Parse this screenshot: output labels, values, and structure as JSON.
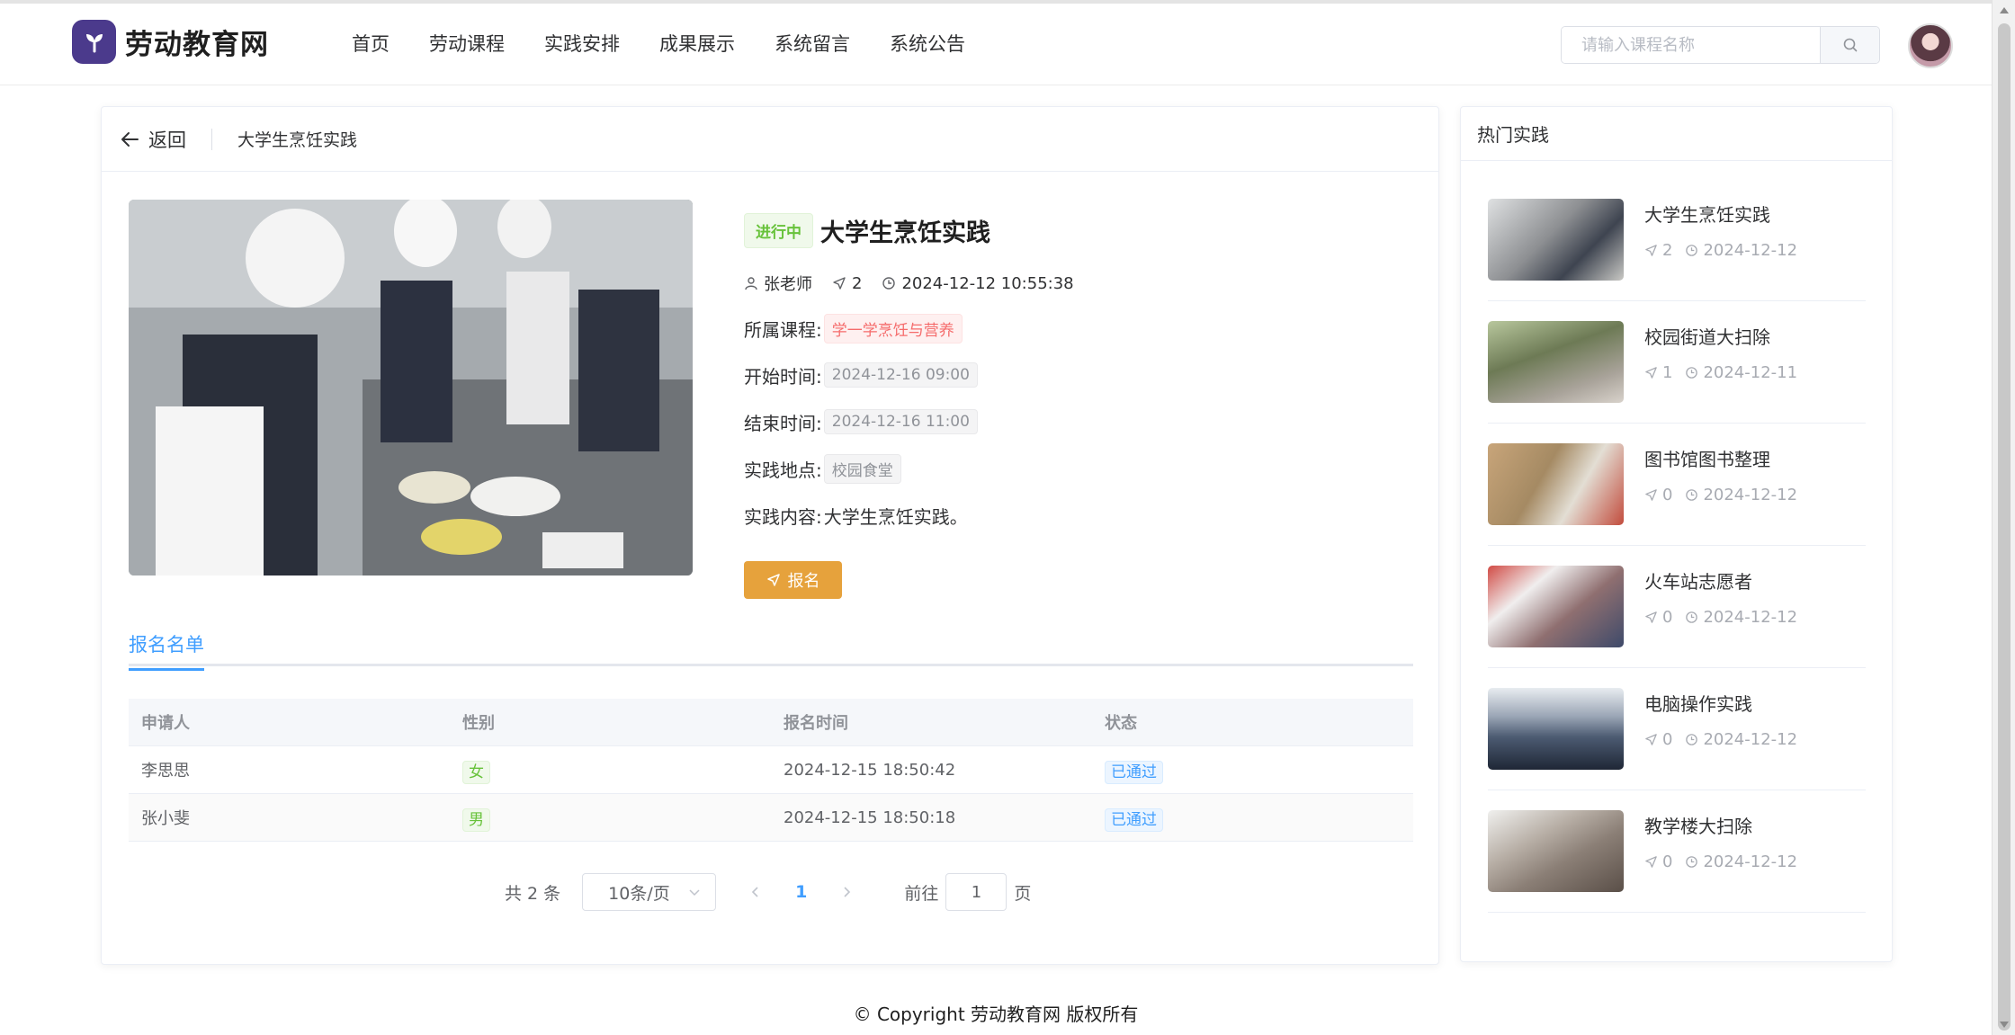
{
  "header": {
    "logo_text": "劳动教育网",
    "nav": [
      "首页",
      "劳动课程",
      "实践安排",
      "成果展示",
      "系统留言",
      "系统公告"
    ],
    "search_placeholder": "请输入课程名称"
  },
  "breadcrumb": {
    "back_label": "返回",
    "current": "大学生烹饪实践"
  },
  "detail": {
    "status": "进行中",
    "title": "大学生烹饪实践",
    "teacher": "张老师",
    "signup_count": "2",
    "published": "2024-12-12 10:55:38",
    "course_label": "所属课程:",
    "course": "学一学烹饪与营养",
    "start_label": "开始时间:",
    "start": "2024-12-16 09:00",
    "end_label": "结束时间:",
    "end": "2024-12-16 11:00",
    "location_label": "实践地点:",
    "location": "校园食堂",
    "content_label": "实践内容:",
    "content": "大学生烹饪实践。",
    "signup_button": "报名"
  },
  "tabs": {
    "active": "报名名单"
  },
  "table": {
    "headers": [
      "申请人",
      "性别",
      "报名时间",
      "状态"
    ],
    "rows": [
      {
        "name": "李思思",
        "gender": "女",
        "time": "2024-12-15 18:50:42",
        "status": "已通过"
      },
      {
        "name": "张小斐",
        "gender": "男",
        "time": "2024-12-15 18:50:18",
        "status": "已通过"
      }
    ]
  },
  "pagination": {
    "total": "共 2 条",
    "page_size": "10条/页",
    "current_page": "1",
    "goto_label": "前往",
    "goto_value": "1",
    "goto_suffix": "页"
  },
  "side": {
    "title": "热门实践",
    "items": [
      {
        "title": "大学生烹饪实践",
        "count": "2",
        "date": "2024-12-12",
        "color": "#8d8f92"
      },
      {
        "title": "校园街道大扫除",
        "count": "1",
        "date": "2024-12-11",
        "color": "#6d7a55"
      },
      {
        "title": "图书馆图书整理",
        "count": "0",
        "date": "2024-12-12",
        "color": "#a58a63"
      },
      {
        "title": "火车站志愿者",
        "count": "0",
        "date": "2024-12-12",
        "color": "#8f6f70"
      },
      {
        "title": "电脑操作实践",
        "count": "0",
        "date": "2024-12-12",
        "color": "#4c5b72"
      },
      {
        "title": "教学楼大扫除",
        "count": "0",
        "date": "2024-12-12",
        "color": "#8b7f76"
      }
    ]
  },
  "footer": {
    "copyright": "© Copyright 劳动教育网 版权所有"
  }
}
